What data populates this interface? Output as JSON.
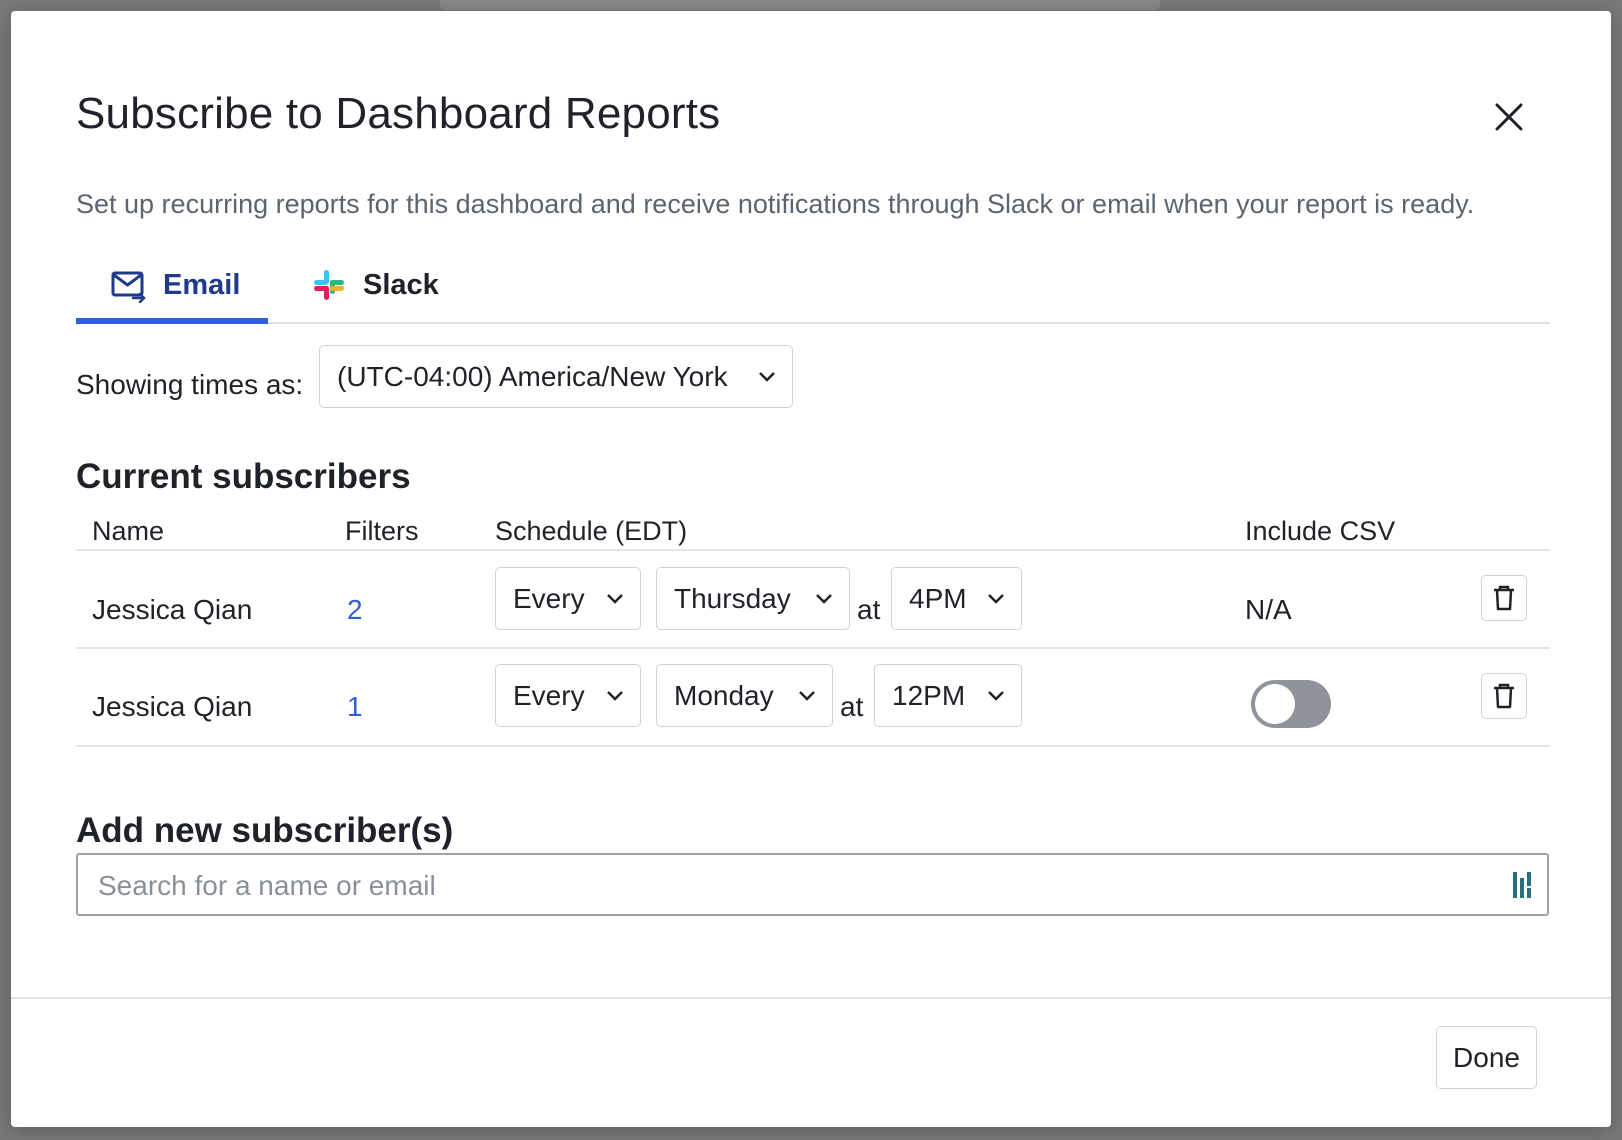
{
  "modal": {
    "title": "Subscribe to Dashboard Reports",
    "subtitle": "Set up recurring reports for this dashboard and receive notifications through Slack or email when your report is ready."
  },
  "tabs": [
    {
      "label": "Email",
      "active": true,
      "icon": "email-icon"
    },
    {
      "label": "Slack",
      "active": false,
      "icon": "slack-icon"
    }
  ],
  "timezone": {
    "label": "Showing times as:",
    "value": "(UTC-04:00) America/New York"
  },
  "current_subscribers": {
    "heading": "Current subscribers",
    "columns": [
      "Name",
      "Filters",
      "Schedule (EDT)",
      "Include CSV"
    ],
    "at_label": "at",
    "rows": [
      {
        "name": "Jessica Qian",
        "filters": "2",
        "frequency": "Every",
        "day": "Thursday",
        "time": "4PM",
        "csv": "N/A",
        "csv_toggle": null
      },
      {
        "name": "Jessica Qian",
        "filters": "1",
        "frequency": "Every",
        "day": "Monday",
        "time": "12PM",
        "csv": "",
        "csv_toggle": false
      }
    ]
  },
  "add_subscribers": {
    "heading": "Add new subscriber(s)",
    "placeholder": "Search for a name or email",
    "value": ""
  },
  "footer": {
    "done_label": "Done"
  },
  "colors": {
    "accent": "#2f5fd8",
    "active_tab_text": "#1f3a8a",
    "toggle_off": "#8f949c"
  }
}
